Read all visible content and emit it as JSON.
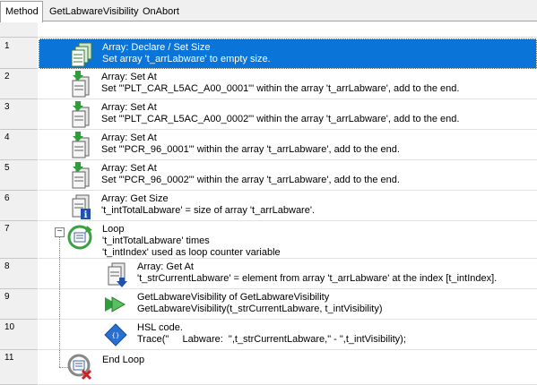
{
  "tabs": [
    {
      "label": "Method"
    },
    {
      "label": "GetLabwareVisibility"
    },
    {
      "label": "OnAbort"
    }
  ],
  "steps": [
    {
      "num": "1",
      "title": "Array: Declare / Set Size",
      "detail": "Set array 't_arrLabware' to empty size.",
      "icon": "array-declare-icon"
    },
    {
      "num": "2",
      "title": "Array: Set At",
      "detail": "Set '\"PLT_CAR_L5AC_A00_0001\"' within the array 't_arrLabware', add to the end.",
      "icon": "array-set-at-icon"
    },
    {
      "num": "3",
      "title": "Array: Set At",
      "detail": "Set '\"PLT_CAR_L5AC_A00_0002\"' within the array 't_arrLabware', add to the end.",
      "icon": "array-set-at-icon"
    },
    {
      "num": "4",
      "title": "Array: Set At",
      "detail": "Set '\"PCR_96_0001\"' within the array 't_arrLabware', add to the end.",
      "icon": "array-set-at-icon"
    },
    {
      "num": "5",
      "title": "Array: Set At",
      "detail": "Set '\"PCR_96_0002\"' within the array 't_arrLabware', add to the end.",
      "icon": "array-set-at-icon"
    },
    {
      "num": "6",
      "title": "Array: Get Size",
      "detail": "'t_intTotalLabware' = size of array 't_arrLabware'.",
      "icon": "array-get-size-icon"
    },
    {
      "num": "7",
      "title": "Loop",
      "detail": "'t_intTotalLabware' times",
      "detail2": "'t_intIndex' used as loop counter variable",
      "icon": "loop-icon"
    },
    {
      "num": "8",
      "title": "Array: Get At",
      "detail": "'t_strCurrentLabware' = element from array 't_arrLabware' at the index [t_intIndex].",
      "icon": "array-get-at-icon"
    },
    {
      "num": "9",
      "title": "GetLabwareVisibility of GetLabwareVisibility",
      "detail": "GetLabwareVisibility(t_strCurrentLabware, t_intVisibility)",
      "icon": "submethod-call-icon"
    },
    {
      "num": "10",
      "title": "HSL code.",
      "detail": "Trace(\"     Labware:  \",t_strCurrentLabware,\" - \",t_intVisibility);",
      "icon": "hsl-code-icon"
    },
    {
      "num": "11",
      "title": "End Loop",
      "icon": "end-loop-icon"
    }
  ],
  "colors": {
    "selection": "#0a74d8",
    "gutter": "#f0f0f0",
    "loop_green": "#3aa040",
    "arrow_green": "#2e9e3a"
  }
}
